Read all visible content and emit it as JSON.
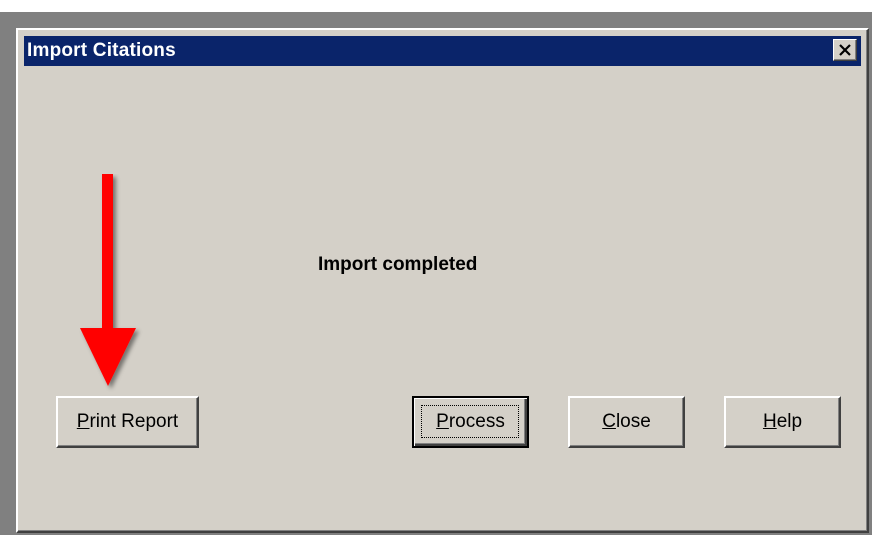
{
  "dialog": {
    "title": "Import Citations",
    "close_glyph": "X"
  },
  "status": {
    "message": "Import completed"
  },
  "buttons": {
    "print_report": {
      "accel": "P",
      "rest": "rint Report"
    },
    "process": {
      "accel": "P",
      "rest": "rocess"
    },
    "close": {
      "accel": "C",
      "rest": "lose"
    },
    "help": {
      "accel": "H",
      "rest": "elp"
    }
  },
  "annotation": {
    "arrow_color": "#ff0000",
    "arrow_target": "print_report"
  },
  "colors": {
    "titlebar": "#0a246a",
    "dialog_face": "#d4d0c8"
  }
}
